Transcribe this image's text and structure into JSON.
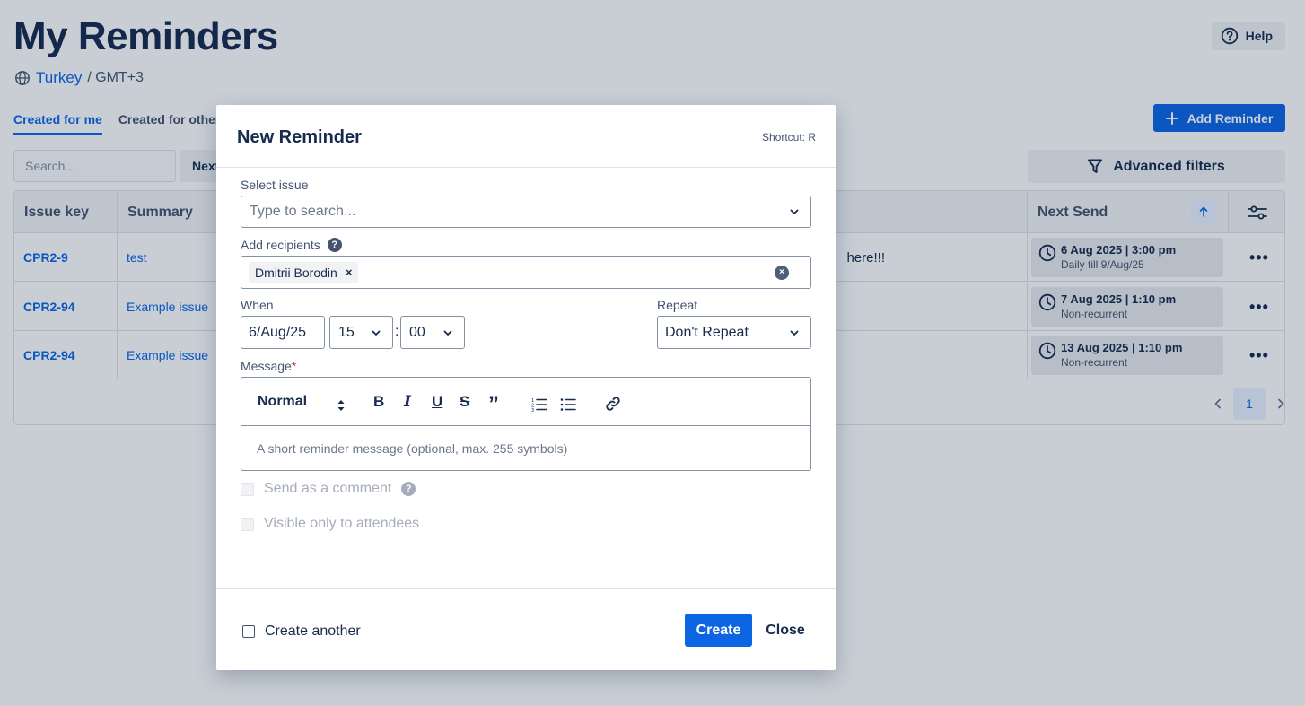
{
  "page": {
    "title": "My Reminders",
    "timezone_link": "Turkey",
    "timezone_suffix": "/ GMT+3",
    "help_label": "Help",
    "tabs": [
      {
        "label": "Created for me",
        "active": true
      },
      {
        "label": "Created for others",
        "active": false
      }
    ],
    "add_reminder_label": "Add Reminder",
    "search_placeholder": "Search...",
    "next_label": "Next",
    "advanced_filters_label": "Advanced filters"
  },
  "table": {
    "headers": {
      "issue_key": "Issue key",
      "summary": "Summary",
      "next_send": "Next Send"
    },
    "rows": [
      {
        "key": "CPR2-9",
        "summary": "test",
        "message_fragment": "here!!!",
        "send_date": "6 Aug 2025 | 3:00 pm",
        "send_sub": "Daily till 9/Aug/25"
      },
      {
        "key": "CPR2-94",
        "summary": "Example issue",
        "message_fragment": "",
        "send_date": "7 Aug 2025 | 1:10 pm",
        "send_sub": "Non-recurrent"
      },
      {
        "key": "CPR2-94",
        "summary": "Example issue",
        "message_fragment": "",
        "send_date": "13 Aug 2025 | 1:10 pm",
        "send_sub": "Non-recurrent"
      }
    ],
    "page_number": "1"
  },
  "modal": {
    "title": "New Reminder",
    "shortcut": "Shortcut: R",
    "select_issue_label": "Select issue",
    "select_issue_placeholder": "Type to search...",
    "add_recipients_label": "Add recipients",
    "recipient": "Dmitrii Borodin",
    "when_label": "When",
    "date_value": "6/Aug/25",
    "hour_value": "15",
    "minute_value": "00",
    "time_separator": ":",
    "repeat_label": "Repeat",
    "repeat_value": "Don't Repeat",
    "message_label": "Message",
    "required_mark": "*",
    "format_value": "Normal",
    "message_placeholder": "A short reminder message (optional, max. 255 symbols)",
    "send_as_comment_label": "Send as a comment",
    "visible_only_label": "Visible only to attendees",
    "create_another_label": "Create another",
    "create_label": "Create",
    "close_label": "Close"
  },
  "colors": {
    "primary": "#0c66e4",
    "text": "#172b4d",
    "overlay": "rgba(9,30,66,0.22)"
  }
}
